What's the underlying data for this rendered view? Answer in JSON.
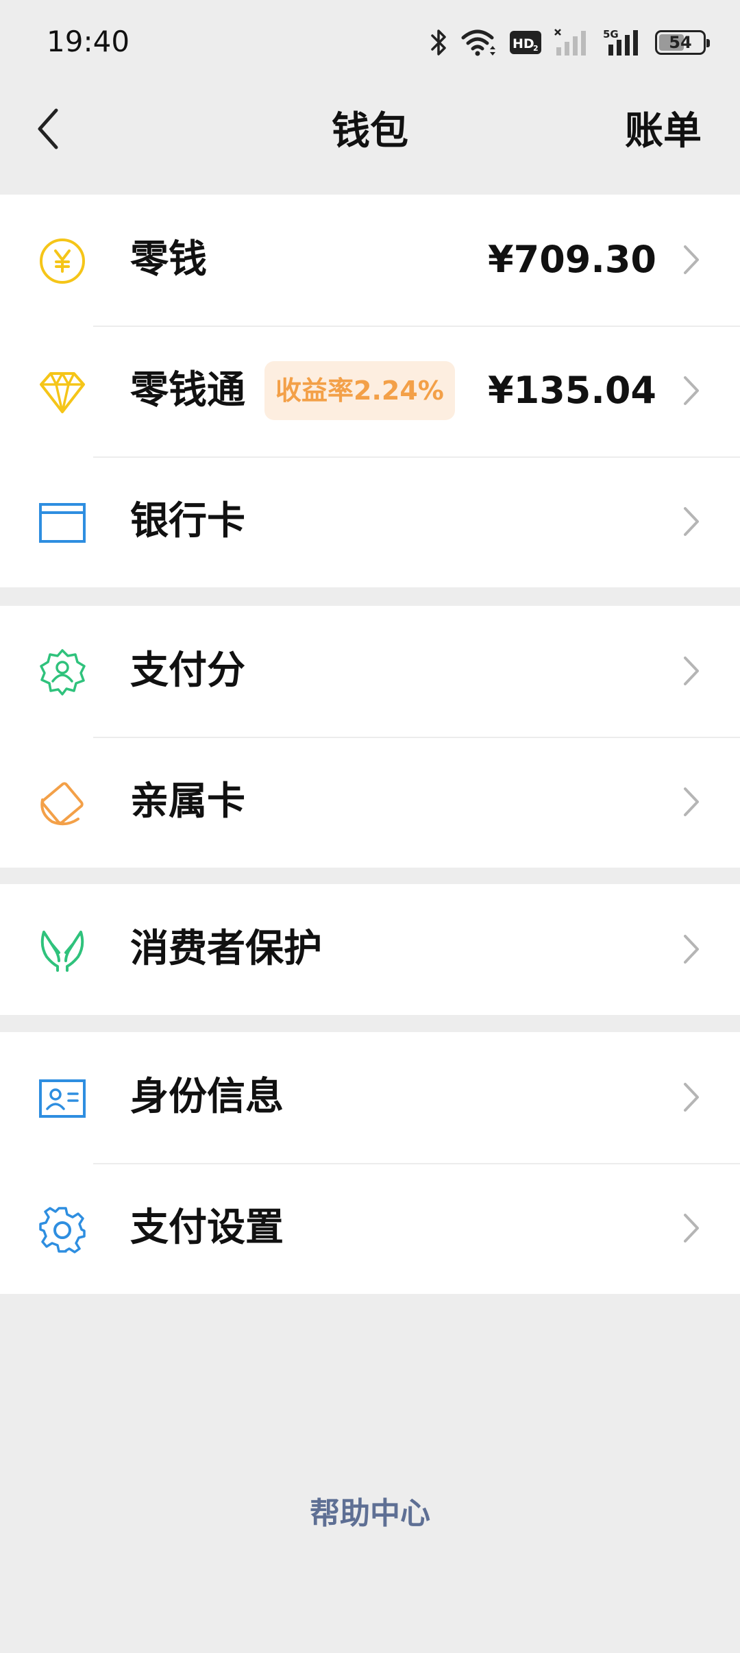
{
  "status_bar": {
    "time": "19:40",
    "battery": "54",
    "icons": [
      "bluetooth-icon",
      "wifi-icon",
      "hd-icon",
      "signal-no-sim-icon",
      "signal-5g-icon",
      "battery-icon"
    ]
  },
  "navbar": {
    "title": "钱包",
    "bills_label": "账单"
  },
  "sections": {
    "funds": {
      "change": {
        "label": "零钱",
        "value": "¥709.30",
        "icon": "yuan-coin-icon"
      },
      "lingqiantong": {
        "label": "零钱通",
        "badge": "收益率2.24%",
        "value": "¥135.04",
        "icon": "diamond-icon"
      },
      "bank_card": {
        "label": "银行卡",
        "icon": "bank-card-icon"
      }
    },
    "services": {
      "pay_score": {
        "label": "支付分",
        "icon": "pay-score-badge-icon"
      },
      "family_card": {
        "label": "亲属卡",
        "icon": "family-card-icon"
      }
    },
    "protection": {
      "consumer": {
        "label": "消费者保护",
        "icon": "protecting-hands-icon"
      }
    },
    "settings": {
      "identity": {
        "label": "身份信息",
        "icon": "id-card-icon"
      },
      "pay_settings": {
        "label": "支付设置",
        "icon": "gear-icon"
      }
    }
  },
  "footer": {
    "help_label": "帮助中心"
  },
  "colors": {
    "background": "#ededed",
    "yellow": "#f5c518",
    "green": "#2fc27c",
    "blue": "#2e8ee0",
    "orange": "#f3a048",
    "link": "#5e6f94"
  }
}
